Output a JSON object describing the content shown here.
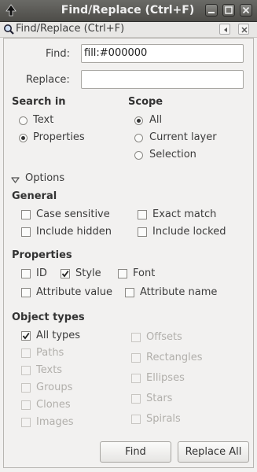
{
  "window": {
    "title": "Find/Replace (Ctrl+F)"
  },
  "dock": {
    "title": "Find/Replace (Ctrl+F)"
  },
  "find": {
    "label": "Find:",
    "value": "fill:#000000"
  },
  "replace": {
    "label": "Replace:",
    "value": ""
  },
  "search_in": {
    "heading": "Search in",
    "options": [
      "Text",
      "Properties"
    ],
    "selected": "Properties"
  },
  "scope": {
    "heading": "Scope",
    "options": [
      "All",
      "Current layer",
      "Selection"
    ],
    "selected": "All"
  },
  "options_expander": {
    "label": "Options"
  },
  "general": {
    "heading": "General",
    "case_sensitive": "Case sensitive",
    "exact_match": "Exact match",
    "include_hidden": "Include hidden",
    "include_locked": "Include locked"
  },
  "properties": {
    "heading": "Properties",
    "id": "ID",
    "style": "Style",
    "font": "Font",
    "attribute_value": "Attribute value",
    "attribute_name": "Attribute name"
  },
  "object_types": {
    "heading": "Object types",
    "all_types": "All types",
    "paths": "Paths",
    "texts": "Texts",
    "groups": "Groups",
    "clones": "Clones",
    "images": "Images",
    "offsets": "Offsets",
    "rectangles": "Rectangles",
    "ellipses": "Ellipses",
    "stars": "Stars",
    "spirals": "Spirals"
  },
  "buttons": {
    "find": "Find",
    "replace_all": "Replace All"
  }
}
